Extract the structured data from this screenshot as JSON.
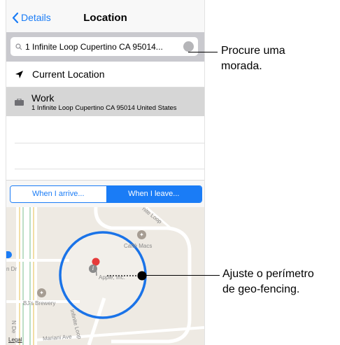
{
  "nav": {
    "back_label": "Details",
    "title": "Location"
  },
  "search": {
    "value": "1 Infinite Loop Cupertino CA 95014..."
  },
  "list": {
    "current_location": "Current Location",
    "work_title": "Work",
    "work_subtitle": "1 Infinite Loop Cupertino CA 95014 United States"
  },
  "segment": {
    "arrive": "When I arrive...",
    "leave": "When I leave...",
    "selected": "leave"
  },
  "map": {
    "cafe": "Caffè Macs",
    "apple": "Apple, Inc.",
    "brewery": "BJ's Brewery",
    "infinite_loop": "Infinite Loop",
    "infinite_loop_top": "nite Loop",
    "mariani": "Mariani Ave",
    "n_de": "N De",
    "dr": "n Dr",
    "legal": "Legal"
  },
  "callouts": {
    "search_line1": "Procure uma",
    "search_line2": "morada.",
    "geofence_line1": "Ajuste o perímetro",
    "geofence_line2": "de geo-fencing."
  },
  "colors": {
    "accent": "#1a7cf6",
    "geofence_ring": "#1a73e8"
  }
}
